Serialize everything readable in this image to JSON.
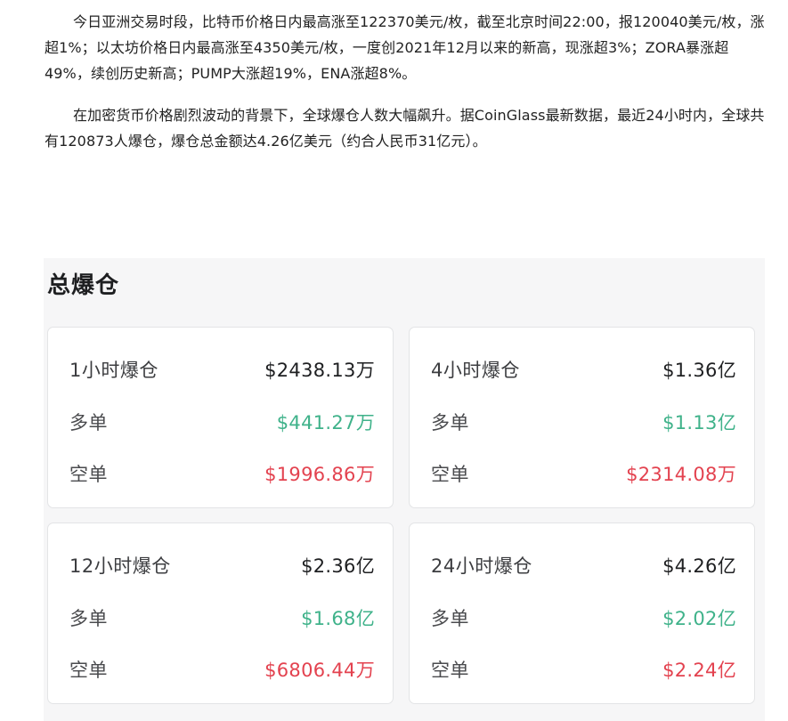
{
  "article": {
    "paragraphs": [
      "今日亚洲交易时段，比特币价格日内最高涨至122370美元/枚，截至北京时间22:00，报120040美元/枚，涨超1%；以太坊价格日内最高涨至4350美元/枚，一度创2021年12月以来的新高，现涨超3%；ZORA暴涨超49%，续创历史新高；PUMP大涨超19%，ENA涨超8%。",
      "在加密货币价格剧烈波动的背景下，全球爆仓人数大幅飙升。据CoinGlass最新数据，最近24小时内，全球共有120873人爆仓，爆仓总金额达4.26亿美元（约合人民币31亿元）。"
    ]
  },
  "widget": {
    "title": "总爆仓",
    "cards": [
      {
        "title": "1小时爆仓",
        "total": "$2438.13万",
        "long_label": "多单",
        "long_value": "$441.27万",
        "short_label": "空单",
        "short_value": "$1996.86万"
      },
      {
        "title": "4小时爆仓",
        "total": "$1.36亿",
        "long_label": "多单",
        "long_value": "$1.13亿",
        "short_label": "空单",
        "short_value": "$2314.08万"
      },
      {
        "title": "12小时爆仓",
        "total": "$2.36亿",
        "long_label": "多单",
        "long_value": "$1.68亿",
        "short_label": "空单",
        "short_value": "$6806.44万"
      },
      {
        "title": "24小时爆仓",
        "total": "$4.26亿",
        "long_label": "多单",
        "long_value": "$2.02亿",
        "short_label": "空单",
        "short_value": "$2.24亿"
      }
    ]
  },
  "colors": {
    "long": "#3fb28a",
    "short": "#e3424f",
    "card_bg": "#ffffff",
    "panel_bg": "#f6f6f7"
  }
}
